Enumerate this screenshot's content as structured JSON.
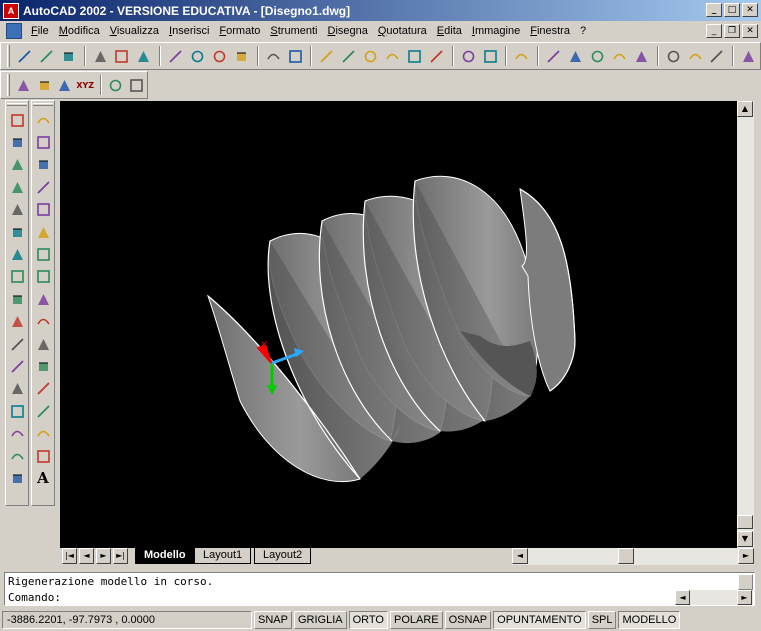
{
  "window": {
    "title": "AutoCAD 2002 - VERSIONE EDUCATIVA - [Disegno1.dwg]"
  },
  "menu": [
    "File",
    "Modifica",
    "Visualizza",
    "Inserisci",
    "Formato",
    "Strumenti",
    "Disegna",
    "Quotatura",
    "Edita",
    "Immagine",
    "Finestra",
    "?"
  ],
  "toolbar_std": [
    "new-icon",
    "open-icon",
    "save-icon",
    "|",
    "print-icon",
    "print-preview-icon",
    "spell-check-icon",
    "|",
    "cut-icon",
    "copy-icon",
    "paste-icon",
    "match-properties-icon",
    "|",
    "undo-icon",
    "redo-icon",
    "|",
    "design-center-icon",
    "hyperlink-icon",
    "today-icon",
    "publish-web-icon",
    "tool-palette-icon",
    "markup-icon",
    "|",
    "ucs-icon",
    "ucs-world-icon",
    "|",
    "aerial-view-icon",
    "|",
    "3d-orbit-icon",
    "pan-icon",
    "zoom-realtime-icon",
    "zoom-window-icon",
    "zoom-previous-icon",
    "|",
    "properties-icon",
    "design-icon",
    "dbconnect-icon",
    "|",
    "help-icon"
  ],
  "toolbar_layers": [
    "layer-manager-icon",
    "layer-previous-icon",
    "layer-state-icon",
    "xyz-icon",
    "|",
    "text-style-icon",
    "dim-style-icon"
  ],
  "palette_modify": [
    "erase-icon",
    "copy-object-icon",
    "mirror-icon",
    "offset-icon",
    "array-icon",
    "move-icon",
    "rotate-icon",
    "scale-icon",
    "stretch-icon",
    "lengthen-icon",
    "trim-icon",
    "extend-icon",
    "break-icon",
    "break-at-point-icon",
    "chamfer-icon",
    "fillet-icon",
    "explode-icon"
  ],
  "palette_draw": [
    "line-icon",
    "construction-line-icon",
    "multiline-icon",
    "polyline-icon",
    "polygon-icon",
    "rectangle-icon",
    "arc-icon",
    "circle-icon",
    "spline-icon",
    "ellipse-icon",
    "revision-cloud-icon",
    "insert-block-icon",
    "make-block-icon",
    "point-icon",
    "hatch-icon",
    "region-icon",
    "multiline-text-icon"
  ],
  "palette_draw_text_glyph": "A",
  "layers_xyz_label": "XYZ",
  "tabs": {
    "model": "Modello",
    "layout1": "Layout1",
    "layout2": "Layout2"
  },
  "scroll": {
    "up": "▲",
    "down": "▼",
    "left": "◄",
    "right": "►"
  },
  "nav": {
    "first": "|◄",
    "prev": "◄",
    "next": "►",
    "last": "►|"
  },
  "ucs": {
    "x_marker": "×"
  },
  "command": {
    "history": "Rigenerazione modello in corso.",
    "prompt": "Comando:"
  },
  "status": {
    "coords": "-3886.2201, -97.7973 , 0.0000",
    "snap": "SNAP",
    "grid": "GRIGLIA",
    "ortho": "ORTO",
    "polar": "POLARE",
    "osnap": "OSNAP",
    "otrack": "OPUNTAMENTO",
    "lwt": "SPL",
    "model": "MODELLO"
  },
  "colors": {
    "viewport_bg": "#000000",
    "surface": "#8c8c8c",
    "edge": "#ffffff",
    "ucs_x": "#ff0000",
    "ucs_y": "#00cc00",
    "ucs_z": "#2aa8ff"
  }
}
